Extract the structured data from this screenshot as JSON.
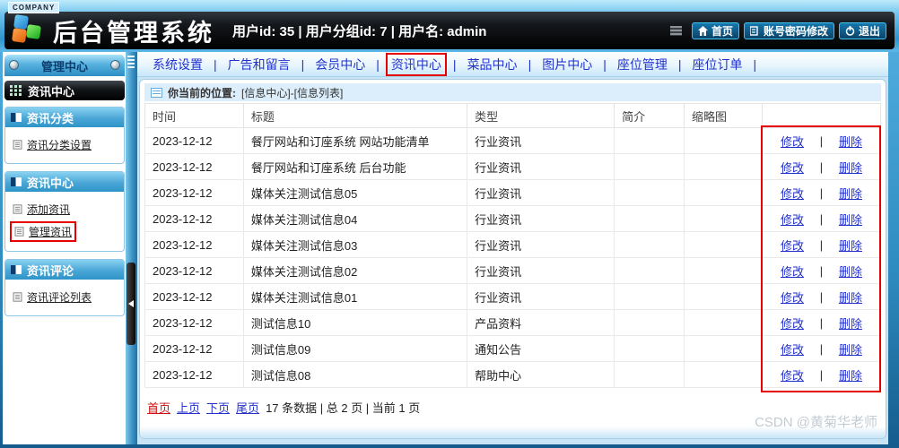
{
  "header": {
    "company_badge": "COMPANY",
    "title": "后台管理系统",
    "user_info": "用户id:  35 | 用户分组id:  7 | 用户名:  admin",
    "buttons": [
      {
        "icon": "home-icon",
        "label": "首页"
      },
      {
        "icon": "edit-account-icon",
        "label": "账号密码修改"
      },
      {
        "icon": "power-icon",
        "label": "退出"
      }
    ]
  },
  "nav": {
    "separator": "|",
    "items": [
      {
        "label": "系统设置",
        "highlighted": false
      },
      {
        "label": "广告和留言",
        "highlighted": false
      },
      {
        "label": "会员中心",
        "highlighted": false
      },
      {
        "label": "资讯中心",
        "highlighted": true
      },
      {
        "label": "菜品中心",
        "highlighted": false
      },
      {
        "label": "图片中心",
        "highlighted": false
      },
      {
        "label": "座位管理",
        "highlighted": false
      },
      {
        "label": "座位订单",
        "highlighted": false
      }
    ]
  },
  "sidebar": {
    "panel_title": "管理中心",
    "active_module": "资讯中心",
    "groups": [
      {
        "title": "资讯分类",
        "items": [
          {
            "label": "资讯分类设置",
            "highlighted": false
          }
        ]
      },
      {
        "title": "资讯中心",
        "items": [
          {
            "label": "添加资讯",
            "highlighted": false
          },
          {
            "label": "管理资讯",
            "highlighted": true
          }
        ]
      },
      {
        "title": "资讯评论",
        "items": [
          {
            "label": "资讯评论列表",
            "highlighted": false
          }
        ]
      }
    ]
  },
  "main": {
    "breadcrumb": {
      "prefix": "你当前的位置:",
      "path": " [信息中心]-[信息列表]"
    },
    "table": {
      "columns": [
        "时间",
        "标题",
        "类型",
        "简介",
        "缩略图",
        ""
      ],
      "actions": {
        "edit": "修改",
        "sep": "|",
        "delete": "删除"
      },
      "rows": [
        {
          "time": "2023-12-12",
          "title": "餐厅网站和订座系统 网站功能清单",
          "type": "行业资讯",
          "intro": "",
          "thumb": ""
        },
        {
          "time": "2023-12-12",
          "title": "餐厅网站和订座系统 后台功能",
          "type": "行业资讯",
          "intro": "",
          "thumb": ""
        },
        {
          "time": "2023-12-12",
          "title": "媒体关注测试信息05",
          "type": "行业资讯",
          "intro": "",
          "thumb": ""
        },
        {
          "time": "2023-12-12",
          "title": "媒体关注测试信息04",
          "type": "行业资讯",
          "intro": "",
          "thumb": ""
        },
        {
          "time": "2023-12-12",
          "title": "媒体关注测试信息03",
          "type": "行业资讯",
          "intro": "",
          "thumb": ""
        },
        {
          "time": "2023-12-12",
          "title": "媒体关注测试信息02",
          "type": "行业资讯",
          "intro": "",
          "thumb": ""
        },
        {
          "time": "2023-12-12",
          "title": "媒体关注测试信息01",
          "type": "行业资讯",
          "intro": "",
          "thumb": ""
        },
        {
          "time": "2023-12-12",
          "title": "测试信息10",
          "type": "产品资料",
          "intro": "",
          "thumb": ""
        },
        {
          "time": "2023-12-12",
          "title": "测试信息09",
          "type": "通知公告",
          "intro": "",
          "thumb": ""
        },
        {
          "time": "2023-12-12",
          "title": "测试信息08",
          "type": "帮助中心",
          "intro": "",
          "thumb": ""
        }
      ]
    },
    "pagination": {
      "first": "首页",
      "prev": "上页",
      "next": "下页",
      "last": "尾页",
      "summary": "17 条数据 | 总 2 页 | 当前 1 页"
    },
    "watermark": "CSDN @黄菊华老师"
  },
  "colors": {
    "highlight_red": "#e60000",
    "link_blue": "#2230cc",
    "link_red": "#cc1111",
    "frame_blue": "#2f8cc0"
  }
}
